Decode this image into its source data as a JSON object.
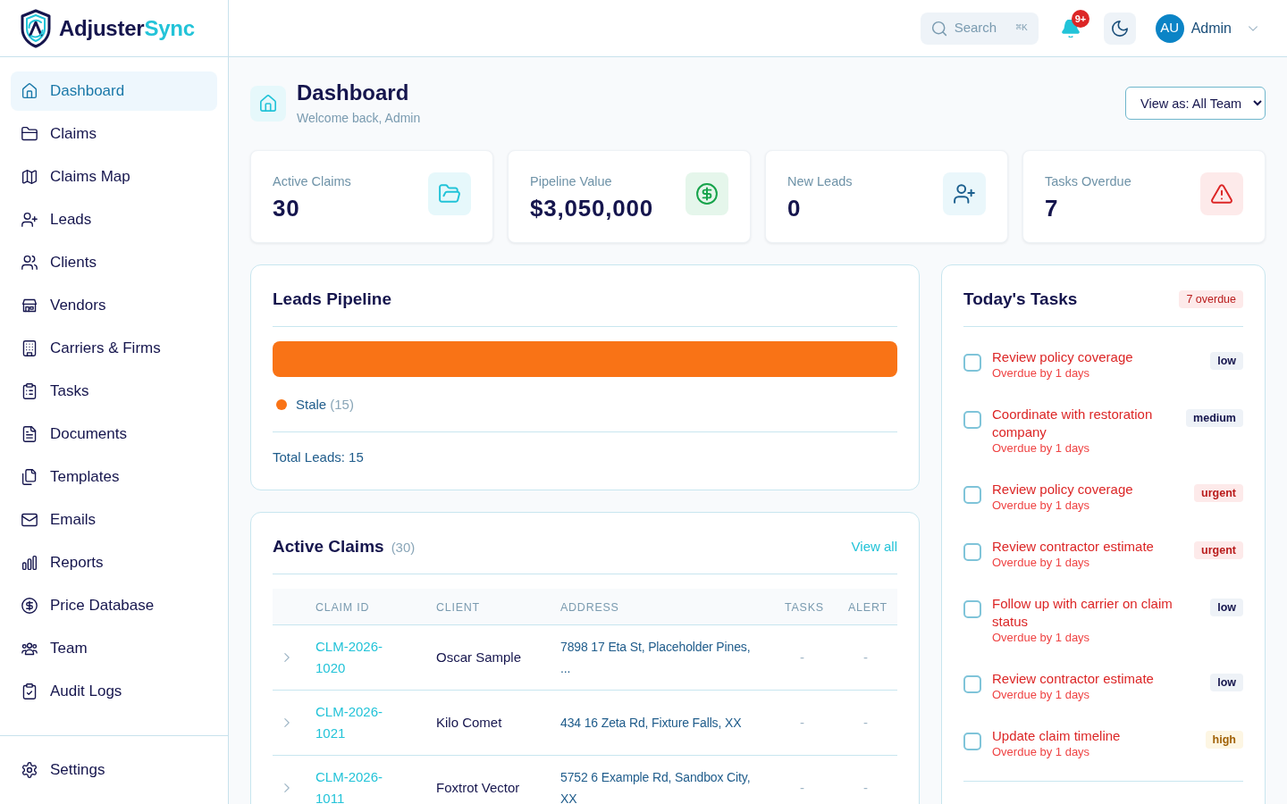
{
  "brand": {
    "wordmark": "Adjuster",
    "wordmark_accent": "Sync"
  },
  "topbar": {
    "search": {
      "label": "Search",
      "shortcut": "⌘K"
    },
    "notifications": {
      "count": "9+"
    },
    "user": {
      "initials": "AU",
      "name": "Admin"
    }
  },
  "sidebar": {
    "items": [
      {
        "label": "Dashboard",
        "selected": true
      },
      {
        "label": "Claims",
        "selected": false
      },
      {
        "label": "Claims Map",
        "selected": false
      },
      {
        "label": "Leads",
        "selected": false
      },
      {
        "label": "Clients",
        "selected": false
      },
      {
        "label": "Vendors",
        "selected": false
      },
      {
        "label": "Carriers & Firms",
        "selected": false
      },
      {
        "label": "Tasks",
        "selected": false
      },
      {
        "label": "Documents",
        "selected": false
      },
      {
        "label": "Templates",
        "selected": false
      },
      {
        "label": "Emails",
        "selected": false
      },
      {
        "label": "Reports",
        "selected": false
      },
      {
        "label": "Price Database",
        "selected": false
      },
      {
        "label": "Team",
        "selected": false
      },
      {
        "label": "Audit Logs",
        "selected": false
      }
    ],
    "footer_items": [
      {
        "label": "Settings",
        "selected": false
      }
    ]
  },
  "page_header": {
    "title": "Dashboard",
    "subtitle": "Welcome back, Admin",
    "view_select": {
      "value": "View as: All Team"
    }
  },
  "stats": [
    {
      "label": "Active Claims",
      "value": "30"
    },
    {
      "label": "Pipeline Value",
      "value": "$3,050,000"
    },
    {
      "label": "New Leads",
      "value": "0"
    },
    {
      "label": "Tasks Overdue",
      "value": "7"
    }
  ],
  "leads_pipeline": {
    "title": "Leads Pipeline",
    "segments": [
      {
        "label": "Stale",
        "count": "(15)",
        "color": "#f97316"
      }
    ],
    "total": "Total Leads: 15"
  },
  "active_claims": {
    "title": "Active Claims",
    "count": "(30)",
    "link": "View all",
    "table": {
      "columns": [
        "CLAIM ID",
        "CLIENT",
        "ADDRESS",
        "TASKS",
        "ALERT"
      ],
      "rows": [
        {
          "claim_id": "CLM-2026-1020",
          "client": "Oscar Sample",
          "address": "7898 17 Eta St, Placeholder Pines, ...",
          "tasks": "-",
          "alert": "-",
          "expanded": false
        },
        {
          "claim_id": "CLM-2026-1021",
          "client": "Kilo Comet",
          "address": "434 16 Zeta Rd, Fixture Falls, XX",
          "tasks": "-",
          "alert": "-",
          "expanded": false
        },
        {
          "claim_id": "CLM-2026-1011",
          "client": "Foxtrot Vector",
          "address": "5752 6 Example Rd, Sandbox City, XX",
          "tasks": "-",
          "alert": "-",
          "expanded": false
        }
      ]
    }
  },
  "todays_tasks": {
    "title": "Today's Tasks",
    "badge": "7 overdue",
    "tasks": [
      {
        "title": "Review policy coverage",
        "due": "Overdue by 1 days",
        "priority": "low",
        "checked": false,
        "overdue": true
      },
      {
        "title": "Coordinate with restoration company",
        "due": "Overdue by 1 days",
        "priority": "medium",
        "checked": false,
        "overdue": true
      },
      {
        "title": "Review policy coverage",
        "due": "Overdue by 1 days",
        "priority": "urgent",
        "checked": false,
        "overdue": true
      },
      {
        "title": "Review contractor estimate",
        "due": "Overdue by 1 days",
        "priority": "urgent",
        "checked": false,
        "overdue": true
      },
      {
        "title": "Follow up with carrier on claim status",
        "due": "Overdue by 1 days",
        "priority": "low",
        "checked": false,
        "overdue": true
      },
      {
        "title": "Review contractor estimate",
        "due": "Overdue by 1 days",
        "priority": "low",
        "checked": false,
        "overdue": true
      },
      {
        "title": "Update claim timeline",
        "due": "Overdue by 1 days",
        "priority": "high",
        "checked": false,
        "overdue": true
      }
    ]
  }
}
